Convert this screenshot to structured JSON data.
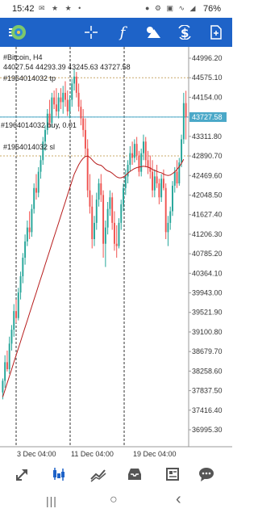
{
  "status_bar": {
    "time": "15:42",
    "left_icons": "✉ ★ ★ •",
    "right_icons": "● ⚙ ▣ ∿ ◢",
    "battery": "76%"
  },
  "toolbar": {
    "icons": [
      "menu-icon",
      "app-logo-icon",
      "crosshair-icon",
      "function-icon",
      "objects-icon",
      "symbol-dollar-icon",
      "new-order-icon"
    ],
    "function_glyph": "f",
    "accent": "#1e63c8"
  },
  "chart": {
    "symbol_line": "#Bitcoin, H4",
    "ohlc_line": "44027.54 44293.39 43245.63 43727.58",
    "tp_label": "#1964014032 tp",
    "buy_label": "#1964014032 buy, 0.01",
    "sl_label": "#1964014032 sl",
    "current_price": "43727.58",
    "price_labels": [
      "44996.20",
      "44575.10",
      "44154.00",
      "43311.80",
      "42890.70",
      "42469.60",
      "42048.50",
      "41627.40",
      "41206.30",
      "40785.20",
      "40364.10",
      "39943.00",
      "39521.90",
      "39100.80",
      "38679.70",
      "38258.60",
      "37837.50",
      "37416.40",
      "36995.30"
    ],
    "date_labels": [
      "3 Dec 04:00",
      "11 Dec 04:00",
      "19 Dec 04:00"
    ],
    "colors": {
      "bull": "#26a69a",
      "bear": "#ef5350",
      "ma": "#b71c1c",
      "current": "#4aa8c8"
    }
  },
  "chart_data": {
    "type": "candlestick",
    "symbol": "#Bitcoin",
    "timeframe": "H4",
    "ylim": [
      36995.3,
      44996.2
    ],
    "current_price": 43727.58,
    "levels": {
      "tp": 44575.1,
      "buy": 43727.58,
      "sl": 42890.7
    },
    "x_labels": [
      "3 Dec 04:00",
      "11 Dec 04:00",
      "19 Dec 04:00"
    ],
    "candles": [
      {
        "o": 37800,
        "h": 38100,
        "l": 37650,
        "c": 38050
      },
      {
        "o": 38050,
        "h": 38600,
        "l": 37900,
        "c": 38450
      },
      {
        "o": 38450,
        "h": 38700,
        "l": 38250,
        "c": 38300
      },
      {
        "o": 38300,
        "h": 39000,
        "l": 38200,
        "c": 38850
      },
      {
        "o": 38850,
        "h": 39250,
        "l": 38700,
        "c": 39150
      },
      {
        "o": 39150,
        "h": 39700,
        "l": 39000,
        "c": 39550
      },
      {
        "o": 39550,
        "h": 39800,
        "l": 39300,
        "c": 39400
      },
      {
        "o": 39400,
        "h": 40050,
        "l": 39350,
        "c": 39950
      },
      {
        "o": 39950,
        "h": 40400,
        "l": 39800,
        "c": 40300
      },
      {
        "o": 40300,
        "h": 40800,
        "l": 40150,
        "c": 40700
      },
      {
        "o": 40700,
        "h": 41200,
        "l": 40550,
        "c": 41050
      },
      {
        "o": 41050,
        "h": 41500,
        "l": 40950,
        "c": 41350
      },
      {
        "o": 41350,
        "h": 41700,
        "l": 41100,
        "c": 41250
      },
      {
        "o": 41250,
        "h": 41850,
        "l": 41150,
        "c": 41750
      },
      {
        "o": 41750,
        "h": 42300,
        "l": 41650,
        "c": 42200
      },
      {
        "o": 42200,
        "h": 42500,
        "l": 41950,
        "c": 42100
      },
      {
        "o": 42100,
        "h": 42650,
        "l": 42000,
        "c": 42550
      },
      {
        "o": 42550,
        "h": 42900,
        "l": 42400,
        "c": 42800
      },
      {
        "o": 42800,
        "h": 43300,
        "l": 42700,
        "c": 43200
      },
      {
        "o": 43200,
        "h": 43550,
        "l": 43000,
        "c": 43450
      },
      {
        "o": 43450,
        "h": 43900,
        "l": 43350,
        "c": 43800
      },
      {
        "o": 43800,
        "h": 44100,
        "l": 43500,
        "c": 43600
      },
      {
        "o": 43600,
        "h": 44250,
        "l": 43500,
        "c": 44150
      },
      {
        "o": 44150,
        "h": 44300,
        "l": 43900,
        "c": 44000
      },
      {
        "o": 44000,
        "h": 44350,
        "l": 43750,
        "c": 43850
      },
      {
        "o": 43850,
        "h": 44250,
        "l": 43700,
        "c": 44150
      },
      {
        "o": 44150,
        "h": 44350,
        "l": 43900,
        "c": 44050
      },
      {
        "o": 44050,
        "h": 44400,
        "l": 43800,
        "c": 44250
      },
      {
        "o": 44250,
        "h": 44500,
        "l": 43950,
        "c": 44100
      },
      {
        "o": 44100,
        "h": 44300,
        "l": 43750,
        "c": 43850
      },
      {
        "o": 43850,
        "h": 44200,
        "l": 43700,
        "c": 44100
      },
      {
        "o": 44100,
        "h": 44550,
        "l": 43950,
        "c": 44450
      },
      {
        "o": 44450,
        "h": 44750,
        "l": 44300,
        "c": 44600
      },
      {
        "o": 44600,
        "h": 44700,
        "l": 44150,
        "c": 44250
      },
      {
        "o": 44250,
        "h": 44450,
        "l": 43850,
        "c": 43950
      },
      {
        "o": 43950,
        "h": 44100,
        "l": 43550,
        "c": 43700
      },
      {
        "o": 43700,
        "h": 43900,
        "l": 43300,
        "c": 43450
      },
      {
        "o": 43450,
        "h": 43700,
        "l": 42900,
        "c": 43050
      },
      {
        "o": 43050,
        "h": 43250,
        "l": 42000,
        "c": 42150
      },
      {
        "o": 42150,
        "h": 42500,
        "l": 41650,
        "c": 41800
      },
      {
        "o": 41800,
        "h": 42050,
        "l": 40900,
        "c": 41100
      },
      {
        "o": 41100,
        "h": 41600,
        "l": 40950,
        "c": 41450
      },
      {
        "o": 41450,
        "h": 42100,
        "l": 41300,
        "c": 41950
      },
      {
        "o": 41950,
        "h": 42400,
        "l": 41800,
        "c": 42300
      },
      {
        "o": 42300,
        "h": 42500,
        "l": 41900,
        "c": 42050
      },
      {
        "o": 42050,
        "h": 42150,
        "l": 40700,
        "c": 41000
      },
      {
        "o": 41000,
        "h": 41500,
        "l": 40500,
        "c": 41350
      },
      {
        "o": 41350,
        "h": 41900,
        "l": 41200,
        "c": 41750
      },
      {
        "o": 41750,
        "h": 42150,
        "l": 41600,
        "c": 42000
      },
      {
        "o": 42000,
        "h": 42100,
        "l": 41300,
        "c": 41450
      },
      {
        "o": 41450,
        "h": 41700,
        "l": 40850,
        "c": 41000
      },
      {
        "o": 41000,
        "h": 41400,
        "l": 40700,
        "c": 40950
      },
      {
        "o": 40950,
        "h": 41550,
        "l": 40900,
        "c": 41450
      },
      {
        "o": 41450,
        "h": 41950,
        "l": 41300,
        "c": 41850
      },
      {
        "o": 41850,
        "h": 42300,
        "l": 41700,
        "c": 42200
      },
      {
        "o": 42200,
        "h": 42600,
        "l": 42050,
        "c": 42450
      },
      {
        "o": 42450,
        "h": 42800,
        "l": 42300,
        "c": 42700
      },
      {
        "o": 42700,
        "h": 43100,
        "l": 42550,
        "c": 42950
      },
      {
        "o": 42950,
        "h": 43200,
        "l": 42700,
        "c": 42850
      },
      {
        "o": 42850,
        "h": 43250,
        "l": 42750,
        "c": 43150
      },
      {
        "o": 43150,
        "h": 43300,
        "l": 42800,
        "c": 42900
      },
      {
        "o": 42900,
        "h": 43000,
        "l": 42450,
        "c": 42550
      },
      {
        "o": 42550,
        "h": 43050,
        "l": 42450,
        "c": 42950
      },
      {
        "o": 42950,
        "h": 43350,
        "l": 42800,
        "c": 43200
      },
      {
        "o": 43200,
        "h": 43300,
        "l": 42650,
        "c": 42800
      },
      {
        "o": 42800,
        "h": 43000,
        "l": 42500,
        "c": 42650
      },
      {
        "o": 42650,
        "h": 42900,
        "l": 42400,
        "c": 42550
      },
      {
        "o": 42550,
        "h": 42800,
        "l": 42000,
        "c": 42150
      },
      {
        "o": 42150,
        "h": 42600,
        "l": 42000,
        "c": 42450
      },
      {
        "o": 42450,
        "h": 42700,
        "l": 42200,
        "c": 42300
      },
      {
        "o": 42300,
        "h": 42400,
        "l": 41850,
        "c": 42000
      },
      {
        "o": 42000,
        "h": 42500,
        "l": 41900,
        "c": 42400
      },
      {
        "o": 42400,
        "h": 42600,
        "l": 42150,
        "c": 42200
      },
      {
        "o": 42200,
        "h": 42300,
        "l": 41100,
        "c": 41250
      },
      {
        "o": 41250,
        "h": 41600,
        "l": 40950,
        "c": 41450
      },
      {
        "o": 41450,
        "h": 41800,
        "l": 41300,
        "c": 41700
      },
      {
        "o": 41700,
        "h": 42350,
        "l": 41600,
        "c": 42250
      },
      {
        "o": 42250,
        "h": 42650,
        "l": 42100,
        "c": 42550
      },
      {
        "o": 42550,
        "h": 42800,
        "l": 42200,
        "c": 42300
      },
      {
        "o": 42300,
        "h": 42850,
        "l": 42250,
        "c": 42750
      },
      {
        "o": 42750,
        "h": 43350,
        "l": 42650,
        "c": 43250
      },
      {
        "o": 43250,
        "h": 44250,
        "l": 43150,
        "c": 44027
      },
      {
        "o": 44027.54,
        "h": 44293.39,
        "l": 43245.63,
        "c": 43727.58
      }
    ],
    "ma": [
      37700,
      37850,
      38000,
      38150,
      38300,
      38450,
      38600,
      38750,
      38900,
      39050,
      39200,
      39350,
      39500,
      39650,
      39800,
      39950,
      40100,
      40250,
      40400,
      40550,
      40700,
      40850,
      41000,
      41150,
      41300,
      41450,
      41600,
      41750,
      41900,
      42050,
      42200,
      42350,
      42500,
      42600,
      42700,
      42780,
      42840,
      42880,
      42890,
      42860,
      42810,
      42760,
      42720,
      42700,
      42690,
      42650,
      42600,
      42570,
      42550,
      42520,
      42480,
      42440,
      42420,
      42420,
      42440,
      42470,
      42520,
      42560,
      42590,
      42620,
      42640,
      42650,
      42660,
      42670,
      42660,
      42650,
      42630,
      42600,
      42580,
      42560,
      42540,
      42530,
      42500,
      42480,
      42470,
      42480,
      42510,
      42550,
      42600,
      42660,
      42730,
      42820
    ]
  },
  "bottom_nav": {
    "items": [
      "quotes-icon",
      "chart-icon",
      "trade-icon",
      "history-icon",
      "news-icon",
      "chat-icon"
    ]
  },
  "system_nav": {
    "recents": "|||",
    "home": "○",
    "back": "‹"
  }
}
